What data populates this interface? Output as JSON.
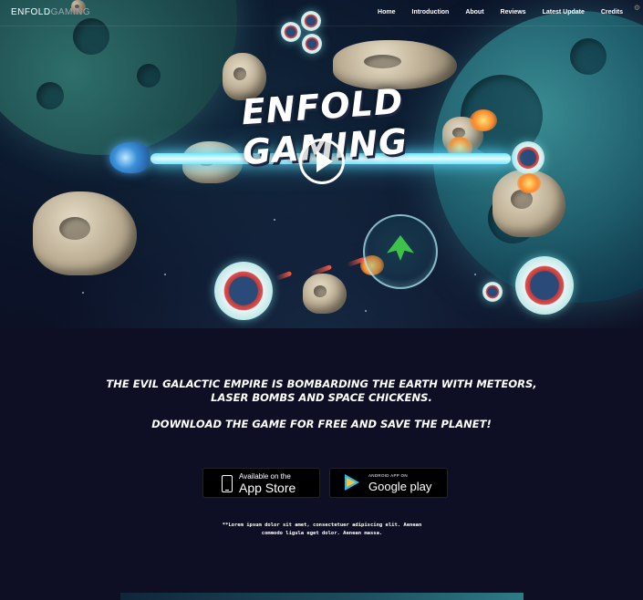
{
  "header": {
    "brand_primary": "ENFOLD",
    "brand_secondary": "GAMING",
    "nav": [
      "Home",
      "Introduction",
      "About",
      "Reviews",
      "Latest Update",
      "Credits"
    ],
    "corner_icon": "settings-icon"
  },
  "hero": {
    "title": "ENFOLD GAMING",
    "play_icon": "play-icon"
  },
  "content": {
    "tagline_line1": "THE EVIL GALACTIC EMPIRE IS BOMBARDING THE EARTH WITH METEORS,",
    "tagline_line2": "LASER BOMBS AND SPACE CHICKENS.",
    "cta": "DOWNLOAD THE GAME FOR FREE AND SAVE THE PLANET!",
    "lorem_line1": "**Lorem ipsum dolor sit amet, consectetuer adipiscing elit. Aenean",
    "lorem_line2": "commodo ligula eget dolor. Aenean massa."
  },
  "badges": {
    "apple_small": "Available on the",
    "apple_big": "App Store",
    "google_small": "ANDROID APP ON",
    "google_big": "Google play"
  },
  "colors": {
    "background": "#0e0f24",
    "laser": "#6fe8ff",
    "planet": "#2d7b86"
  }
}
